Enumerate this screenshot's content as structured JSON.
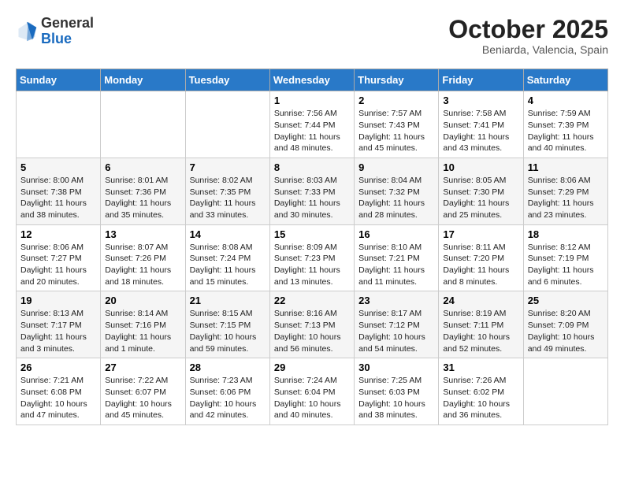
{
  "header": {
    "logo_line1": "General",
    "logo_line2": "Blue",
    "month_title": "October 2025",
    "location": "Beniarda, Valencia, Spain"
  },
  "days_of_week": [
    "Sunday",
    "Monday",
    "Tuesday",
    "Wednesday",
    "Thursday",
    "Friday",
    "Saturday"
  ],
  "weeks": [
    [
      {
        "day": "",
        "info": ""
      },
      {
        "day": "",
        "info": ""
      },
      {
        "day": "",
        "info": ""
      },
      {
        "day": "1",
        "info": "Sunrise: 7:56 AM\nSunset: 7:44 PM\nDaylight: 11 hours\nand 48 minutes."
      },
      {
        "day": "2",
        "info": "Sunrise: 7:57 AM\nSunset: 7:43 PM\nDaylight: 11 hours\nand 45 minutes."
      },
      {
        "day": "3",
        "info": "Sunrise: 7:58 AM\nSunset: 7:41 PM\nDaylight: 11 hours\nand 43 minutes."
      },
      {
        "day": "4",
        "info": "Sunrise: 7:59 AM\nSunset: 7:39 PM\nDaylight: 11 hours\nand 40 minutes."
      }
    ],
    [
      {
        "day": "5",
        "info": "Sunrise: 8:00 AM\nSunset: 7:38 PM\nDaylight: 11 hours\nand 38 minutes."
      },
      {
        "day": "6",
        "info": "Sunrise: 8:01 AM\nSunset: 7:36 PM\nDaylight: 11 hours\nand 35 minutes."
      },
      {
        "day": "7",
        "info": "Sunrise: 8:02 AM\nSunset: 7:35 PM\nDaylight: 11 hours\nand 33 minutes."
      },
      {
        "day": "8",
        "info": "Sunrise: 8:03 AM\nSunset: 7:33 PM\nDaylight: 11 hours\nand 30 minutes."
      },
      {
        "day": "9",
        "info": "Sunrise: 8:04 AM\nSunset: 7:32 PM\nDaylight: 11 hours\nand 28 minutes."
      },
      {
        "day": "10",
        "info": "Sunrise: 8:05 AM\nSunset: 7:30 PM\nDaylight: 11 hours\nand 25 minutes."
      },
      {
        "day": "11",
        "info": "Sunrise: 8:06 AM\nSunset: 7:29 PM\nDaylight: 11 hours\nand 23 minutes."
      }
    ],
    [
      {
        "day": "12",
        "info": "Sunrise: 8:06 AM\nSunset: 7:27 PM\nDaylight: 11 hours\nand 20 minutes."
      },
      {
        "day": "13",
        "info": "Sunrise: 8:07 AM\nSunset: 7:26 PM\nDaylight: 11 hours\nand 18 minutes."
      },
      {
        "day": "14",
        "info": "Sunrise: 8:08 AM\nSunset: 7:24 PM\nDaylight: 11 hours\nand 15 minutes."
      },
      {
        "day": "15",
        "info": "Sunrise: 8:09 AM\nSunset: 7:23 PM\nDaylight: 11 hours\nand 13 minutes."
      },
      {
        "day": "16",
        "info": "Sunrise: 8:10 AM\nSunset: 7:21 PM\nDaylight: 11 hours\nand 11 minutes."
      },
      {
        "day": "17",
        "info": "Sunrise: 8:11 AM\nSunset: 7:20 PM\nDaylight: 11 hours\nand 8 minutes."
      },
      {
        "day": "18",
        "info": "Sunrise: 8:12 AM\nSunset: 7:19 PM\nDaylight: 11 hours\nand 6 minutes."
      }
    ],
    [
      {
        "day": "19",
        "info": "Sunrise: 8:13 AM\nSunset: 7:17 PM\nDaylight: 11 hours\nand 3 minutes."
      },
      {
        "day": "20",
        "info": "Sunrise: 8:14 AM\nSunset: 7:16 PM\nDaylight: 11 hours\nand 1 minute."
      },
      {
        "day": "21",
        "info": "Sunrise: 8:15 AM\nSunset: 7:15 PM\nDaylight: 10 hours\nand 59 minutes."
      },
      {
        "day": "22",
        "info": "Sunrise: 8:16 AM\nSunset: 7:13 PM\nDaylight: 10 hours\nand 56 minutes."
      },
      {
        "day": "23",
        "info": "Sunrise: 8:17 AM\nSunset: 7:12 PM\nDaylight: 10 hours\nand 54 minutes."
      },
      {
        "day": "24",
        "info": "Sunrise: 8:19 AM\nSunset: 7:11 PM\nDaylight: 10 hours\nand 52 minutes."
      },
      {
        "day": "25",
        "info": "Sunrise: 8:20 AM\nSunset: 7:09 PM\nDaylight: 10 hours\nand 49 minutes."
      }
    ],
    [
      {
        "day": "26",
        "info": "Sunrise: 7:21 AM\nSunset: 6:08 PM\nDaylight: 10 hours\nand 47 minutes."
      },
      {
        "day": "27",
        "info": "Sunrise: 7:22 AM\nSunset: 6:07 PM\nDaylight: 10 hours\nand 45 minutes."
      },
      {
        "day": "28",
        "info": "Sunrise: 7:23 AM\nSunset: 6:06 PM\nDaylight: 10 hours\nand 42 minutes."
      },
      {
        "day": "29",
        "info": "Sunrise: 7:24 AM\nSunset: 6:04 PM\nDaylight: 10 hours\nand 40 minutes."
      },
      {
        "day": "30",
        "info": "Sunrise: 7:25 AM\nSunset: 6:03 PM\nDaylight: 10 hours\nand 38 minutes."
      },
      {
        "day": "31",
        "info": "Sunrise: 7:26 AM\nSunset: 6:02 PM\nDaylight: 10 hours\nand 36 minutes."
      },
      {
        "day": "",
        "info": ""
      }
    ]
  ]
}
